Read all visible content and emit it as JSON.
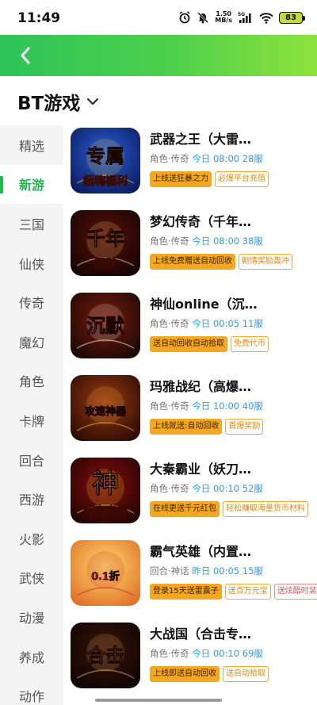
{
  "status": {
    "time": "11:49",
    "speed_top": "1.50",
    "speed_bottom": "MB/s",
    "network": "5G",
    "battery": "83"
  },
  "header": {
    "title": "BT游戏"
  },
  "sidebar": {
    "items": [
      {
        "label": "精选",
        "active": false
      },
      {
        "label": "新游",
        "active": true
      },
      {
        "label": "三国",
        "active": false
      },
      {
        "label": "仙侠",
        "active": false
      },
      {
        "label": "传奇",
        "active": false
      },
      {
        "label": "魔幻",
        "active": false
      },
      {
        "label": "角色",
        "active": false
      },
      {
        "label": "卡牌",
        "active": false
      },
      {
        "label": "回合",
        "active": false
      },
      {
        "label": "西游",
        "active": false
      },
      {
        "label": "火影",
        "active": false
      },
      {
        "label": "武侠",
        "active": false
      },
      {
        "label": "动漫",
        "active": false
      },
      {
        "label": "养成",
        "active": false
      },
      {
        "label": "动作",
        "active": false
      }
    ]
  },
  "games": [
    {
      "name": "武器之王（大雷…",
      "category": "角色·传奇",
      "time": "今日 08:00",
      "server": "28服",
      "tag1": "上线送狂暴之力",
      "tag2": "必爆平台充值",
      "tag3": "",
      "icon": {
        "bg1": "#2b5fd6",
        "bg2": "#0b1a5c",
        "accent": "#ffd02a",
        "text1": "专属",
        "text2": "超嗨福利"
      }
    },
    {
      "name": "梦幻传奇（千年…",
      "category": "角色·传奇",
      "time": "今日 08:00",
      "server": "38服",
      "tag1": "上线免费赠送自动回收",
      "tag2": "剧情奖励轰冲",
      "tag3": "",
      "icon": {
        "bg1": "#5a0f08",
        "bg2": "#140403",
        "accent": "#ffe07a",
        "text1": "千年",
        "text2": "沉默"
      }
    },
    {
      "name": "神仙online（沉…",
      "category": "角色·传奇",
      "time": "今日 00:05",
      "server": "11服",
      "tag1": "送自动回收自动拾取",
      "tag2": "免费代币",
      "tag3": "",
      "icon": {
        "bg1": "#7a1a0a",
        "bg2": "#1a0806",
        "accent": "#f2f2f2",
        "text1": "沉默",
        "text2": ""
      }
    },
    {
      "name": "玛雅战纪（高爆…",
      "category": "角色·传奇",
      "time": "今日 10:00",
      "server": "40服",
      "tag1": "上线就送:自动回收",
      "tag2": "首爆奖励",
      "tag3": "",
      "icon": {
        "bg1": "#9a3a10",
        "bg2": "#2a0a04",
        "accent": "#ffb840",
        "text1": "攻速神器",
        "text2": ""
      }
    },
    {
      "name": "大秦霸业（妖刀…",
      "category": "角色·传奇",
      "time": "今日 00:10",
      "server": "52服",
      "tag1": "在线更送千元红包",
      "tag2": "轻松赚取海量货币材料",
      "tag3": "",
      "icon": {
        "bg1": "#8a0c0c",
        "bg2": "#1e0404",
        "accent": "#ffd83a",
        "text1": "神",
        "text2": "超爽高爆"
      }
    },
    {
      "name": "霸气英雄（内置…",
      "category": "回合·神话",
      "time": "昨日 00:05",
      "server": "15服",
      "tag1": "登录15天送雷震子",
      "tag2": "送百万元宝",
      "tag3": "送炫酷时装",
      "icon": {
        "bg1": "#ffd86a",
        "bg2": "#e0702a",
        "accent": "#c0202a",
        "text1": "0.1折",
        "text2": ""
      }
    },
    {
      "name": "大战国（合击专…",
      "category": "角色·传奇",
      "time": "今日 00:10",
      "server": "69服",
      "tag1": "上线即送自动回收",
      "tag2": "送自动拾取",
      "tag3": "",
      "icon": {
        "bg1": "#3a1208",
        "bg2": "#0e0402",
        "accent": "#e8c070",
        "text1": "合击",
        "text2": ""
      }
    }
  ]
}
